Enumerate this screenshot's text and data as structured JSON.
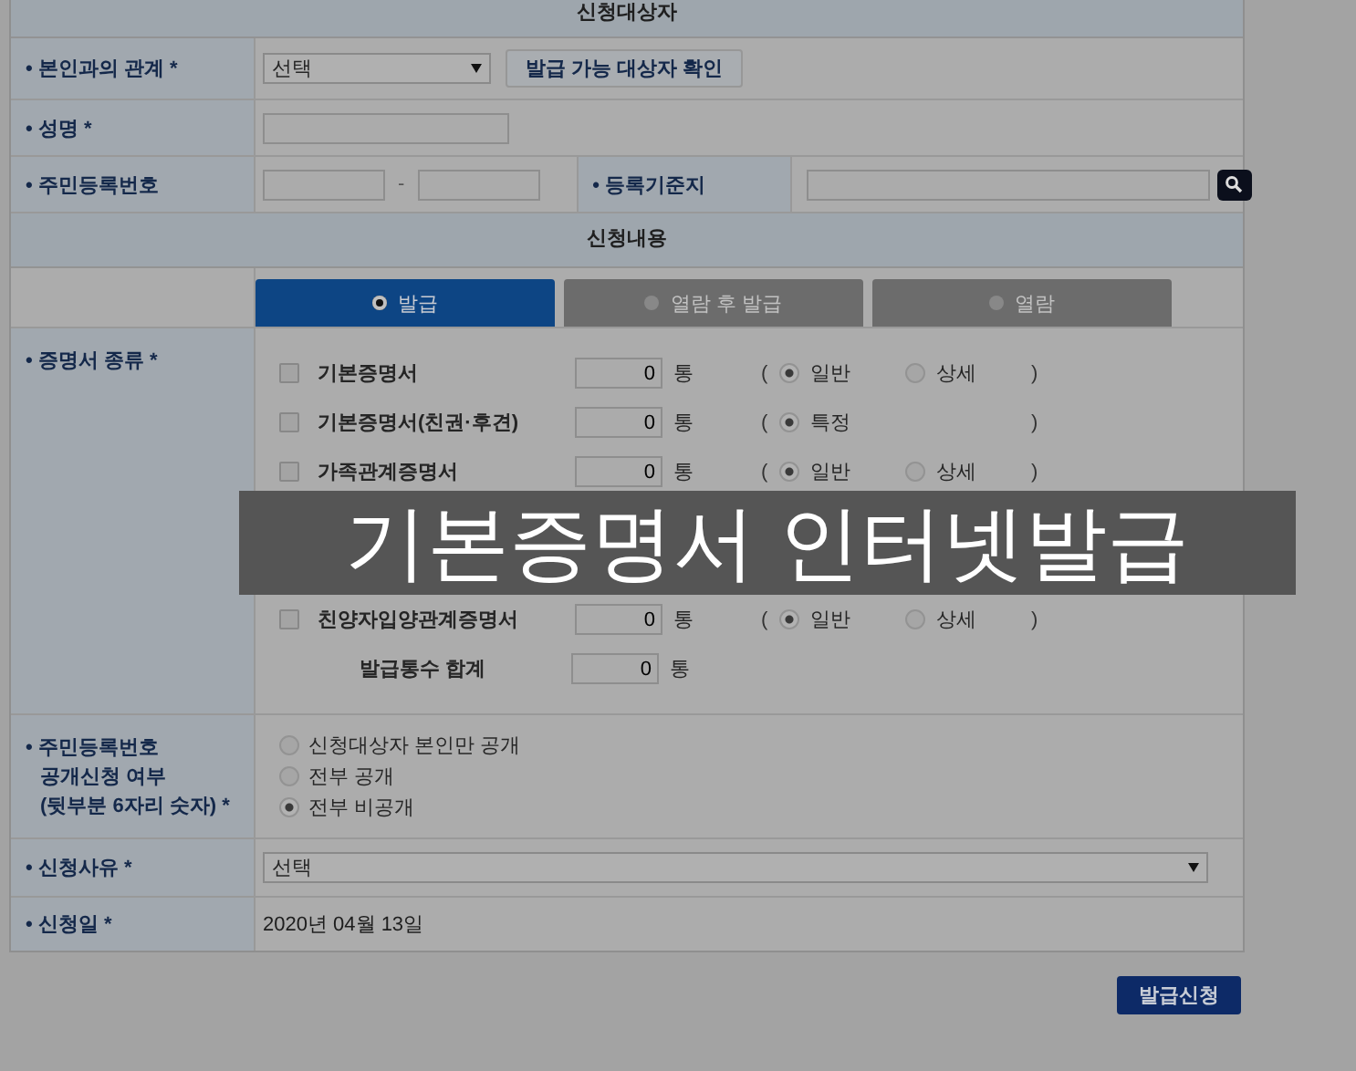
{
  "target": {
    "title": "신청대상자",
    "relation": {
      "label": "• 본인과의 관계 *",
      "select": "선택",
      "button": "발급 가능 대상자 확인"
    },
    "name": {
      "label": "• 성명 *"
    },
    "rrn": {
      "label": "• 주민등록번호",
      "separator": "-"
    },
    "registry": {
      "label": "• 등록기준지"
    }
  },
  "content": {
    "title": "신청내용",
    "modes": [
      {
        "label": "발급",
        "selected": true
      },
      {
        "label": "열람 후 발급",
        "selected": false
      },
      {
        "label": "열람",
        "selected": false
      }
    ],
    "certificates": {
      "label": "• 증명서 종류 *",
      "rows": [
        {
          "kind": "item",
          "name": "기본증명서",
          "checked": false,
          "count": "0",
          "unit": "통",
          "open": "(",
          "close": ")",
          "options": [
            {
              "label": "일반",
              "selected": true
            },
            {
              "label": "상세",
              "selected": false
            }
          ]
        },
        {
          "kind": "item",
          "name": "기본증명서(친권·후견)",
          "checked": false,
          "count": "0",
          "unit": "통",
          "open": "(",
          "close": ")",
          "options": [
            {
              "label": "특정",
              "selected": true
            }
          ]
        },
        {
          "kind": "item",
          "name": "가족관계증명서",
          "checked": false,
          "count": "0",
          "unit": "통",
          "open": "(",
          "close": ")",
          "options": [
            {
              "label": "일반",
              "selected": true
            },
            {
              "label": "상세",
              "selected": false
            }
          ]
        },
        {
          "kind": "covered"
        },
        {
          "kind": "covered"
        },
        {
          "kind": "item",
          "name": "친양자입양관계증명서",
          "checked": false,
          "count": "0",
          "unit": "통",
          "open": "(",
          "close": ")",
          "options": [
            {
              "label": "일반",
              "selected": true
            },
            {
              "label": "상세",
              "selected": false
            }
          ]
        },
        {
          "kind": "total",
          "name": "발급통수 합계",
          "count": "0",
          "unit": "통"
        }
      ]
    },
    "disclosure": {
      "label_lines": [
        "• 주민등록번호",
        "공개신청 여부",
        "(뒷부분 6자리 숫자) *"
      ],
      "options": [
        {
          "label": "신청대상자 본인만 공개",
          "selected": false
        },
        {
          "label": "전부 공개",
          "selected": false
        },
        {
          "label": "전부 비공개",
          "selected": true
        }
      ]
    },
    "reason": {
      "label": "• 신청사유 *",
      "select": "선택"
    },
    "date": {
      "label": "• 신청일 *",
      "value": "2020년 04월 13일"
    }
  },
  "submit": "발급신청",
  "banner": "기본증명서 인터넷발급"
}
